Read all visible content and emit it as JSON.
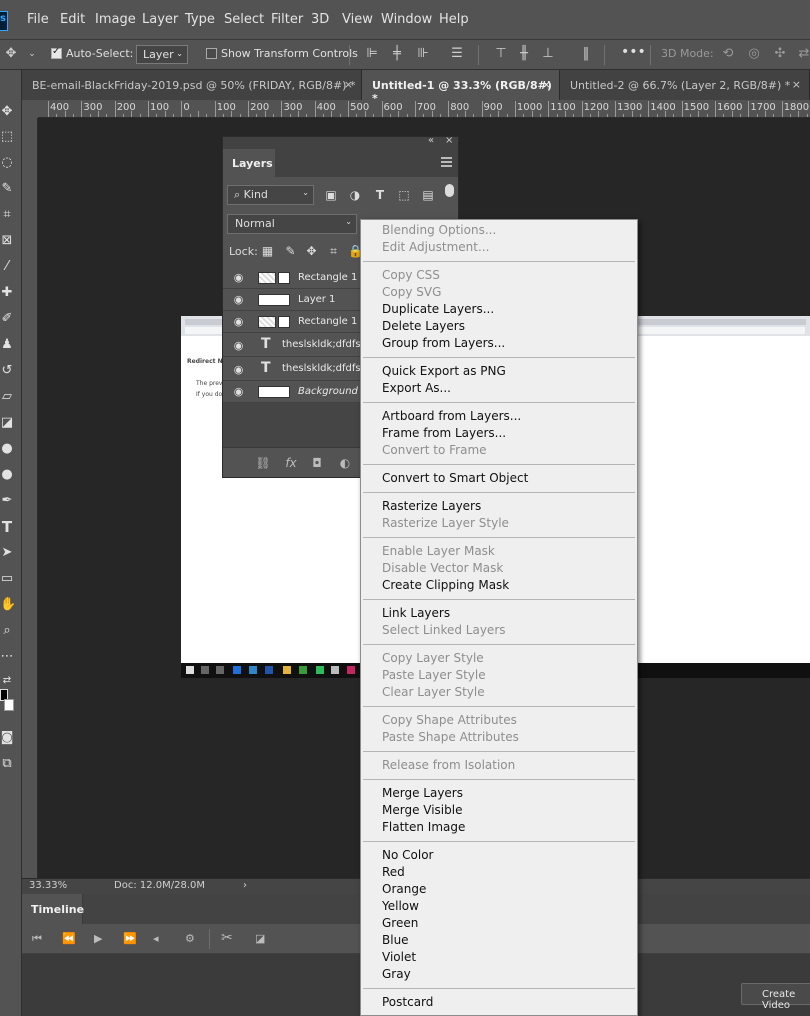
{
  "menubar": {
    "logo": "Ps",
    "items": [
      "File",
      "Edit",
      "Image",
      "Layer",
      "Type",
      "Select",
      "Filter",
      "3D",
      "View",
      "Window",
      "Help"
    ]
  },
  "options": {
    "auto_select_label": "Auto-Select:",
    "auto_select_target": "Layer",
    "show_transform_label": "Show Transform Controls",
    "more": "•••",
    "mode_3d": "3D Mode:"
  },
  "tabs": [
    {
      "label": "BE-email-BlackFriday-2019.psd @ 50% (FRIDAY, RGB/8#) *",
      "active": false
    },
    {
      "label": "Untitled-1 @ 33.3% (RGB/8#) *",
      "active": true
    },
    {
      "label": "Untitled-2 @ 66.7% (Layer 2, RGB/8#) *",
      "active": false
    }
  ],
  "ruler": [
    "400",
    "300",
    "200",
    "100",
    "0",
    "100",
    "200",
    "300",
    "400",
    "500",
    "600",
    "700",
    "800",
    "900",
    "1000",
    "1100",
    "1200",
    "1300",
    "1400",
    "1500",
    "1600",
    "1700",
    "1800"
  ],
  "status": {
    "zoom": "33.33%",
    "doc": "Doc: 12.0M/28.0M",
    "arrow": "›"
  },
  "timeline": {
    "tab": "Timeline",
    "create_video": "Create Video"
  },
  "layers_panel": {
    "title": "Layers",
    "collapse": "«",
    "close": "×",
    "filter_kind": "Kind",
    "blend_mode": "Normal",
    "lock_label": "Lock:",
    "layers": [
      {
        "name": "Rectangle 1 co",
        "type": "shape"
      },
      {
        "name": "Layer 1",
        "type": "pixel"
      },
      {
        "name": "Rectangle 1",
        "type": "shape"
      },
      {
        "name": "theslskldk;dfdfs d",
        "type": "text"
      },
      {
        "name": "theslskldk;dfdfs",
        "type": "text"
      },
      {
        "name": "Background",
        "type": "background"
      }
    ]
  },
  "document": {
    "header": "Redirect No",
    "line1": "The previ",
    "line2": "If you do n"
  },
  "context_menu": {
    "groups": [
      [
        {
          "label": "Blending Options...",
          "disabled": true
        },
        {
          "label": "Edit Adjustment...",
          "disabled": true
        }
      ],
      [
        {
          "label": "Copy CSS",
          "disabled": true
        },
        {
          "label": "Copy SVG",
          "disabled": true
        },
        {
          "label": "Duplicate Layers...",
          "disabled": false
        },
        {
          "label": "Delete Layers",
          "disabled": false
        },
        {
          "label": "Group from Layers...",
          "disabled": false
        }
      ],
      [
        {
          "label": "Quick Export as PNG",
          "disabled": false
        },
        {
          "label": "Export As...",
          "disabled": false
        }
      ],
      [
        {
          "label": "Artboard from Layers...",
          "disabled": false
        },
        {
          "label": "Frame from Layers...",
          "disabled": false
        },
        {
          "label": "Convert to Frame",
          "disabled": true
        }
      ],
      [
        {
          "label": "Convert to Smart Object",
          "disabled": false
        }
      ],
      [
        {
          "label": "Rasterize Layers",
          "disabled": false
        },
        {
          "label": "Rasterize Layer Style",
          "disabled": true
        }
      ],
      [
        {
          "label": "Enable Layer Mask",
          "disabled": true
        },
        {
          "label": "Disable Vector Mask",
          "disabled": true
        },
        {
          "label": "Create Clipping Mask",
          "disabled": false
        }
      ],
      [
        {
          "label": "Link Layers",
          "disabled": false
        },
        {
          "label": "Select Linked Layers",
          "disabled": true
        }
      ],
      [
        {
          "label": "Copy Layer Style",
          "disabled": true
        },
        {
          "label": "Paste Layer Style",
          "disabled": true
        },
        {
          "label": "Clear Layer Style",
          "disabled": true
        }
      ],
      [
        {
          "label": "Copy Shape Attributes",
          "disabled": true
        },
        {
          "label": "Paste Shape Attributes",
          "disabled": true
        }
      ],
      [
        {
          "label": "Release from Isolation",
          "disabled": true
        }
      ],
      [
        {
          "label": "Merge Layers",
          "disabled": false
        },
        {
          "label": "Merge Visible",
          "disabled": false
        },
        {
          "label": "Flatten Image",
          "disabled": false
        }
      ],
      [
        {
          "label": "No Color",
          "disabled": false
        },
        {
          "label": "Red",
          "disabled": false
        },
        {
          "label": "Orange",
          "disabled": false
        },
        {
          "label": "Yellow",
          "disabled": false
        },
        {
          "label": "Green",
          "disabled": false
        },
        {
          "label": "Blue",
          "disabled": false
        },
        {
          "label": "Violet",
          "disabled": false
        },
        {
          "label": "Gray",
          "disabled": false
        }
      ],
      [
        {
          "label": "Postcard",
          "disabled": false
        }
      ]
    ]
  }
}
